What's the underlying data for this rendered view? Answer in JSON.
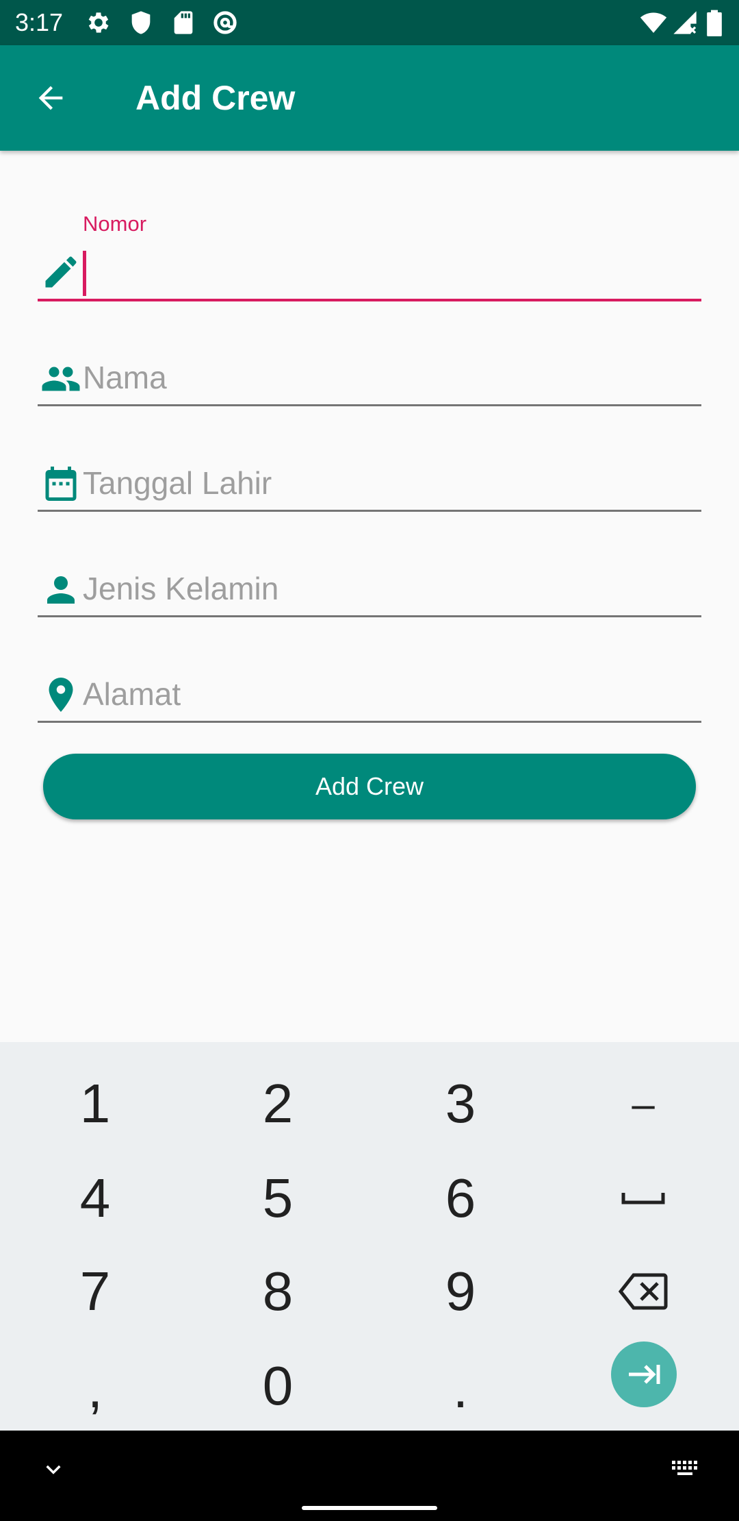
{
  "status_bar": {
    "time": "3:17",
    "left_icons": [
      "gear-icon",
      "shield-icon",
      "sd-card-icon",
      "at-sign-icon"
    ],
    "right_icons": [
      "wifi-icon",
      "signal-icon",
      "battery-icon"
    ]
  },
  "app_bar": {
    "title": "Add Crew",
    "back_icon": "arrow-back-icon",
    "color": "#00897b"
  },
  "form": {
    "fields": [
      {
        "label": "Nomor",
        "value": "",
        "icon": "pencil-icon",
        "focused": true
      },
      {
        "placeholder": "Nama",
        "icon": "people-icon"
      },
      {
        "placeholder": "Tanggal Lahir",
        "icon": "calendar-icon"
      },
      {
        "placeholder": "Jenis Kelamin",
        "icon": "person-icon"
      },
      {
        "placeholder": "Alamat",
        "icon": "location-pin-icon"
      }
    ],
    "submit_label": "Add Crew",
    "accent_color": "#d81b60",
    "icon_color": "#00897b"
  },
  "keyboard": {
    "keys": [
      "1",
      "2",
      "3",
      "–",
      "4",
      "5",
      "6",
      "space",
      "7",
      "8",
      "9",
      "backspace",
      ",",
      "0",
      ".",
      "next"
    ]
  },
  "nav_bar": {
    "icons": [
      "chevron-down-icon",
      "keyboard-icon",
      "home-handle"
    ]
  }
}
